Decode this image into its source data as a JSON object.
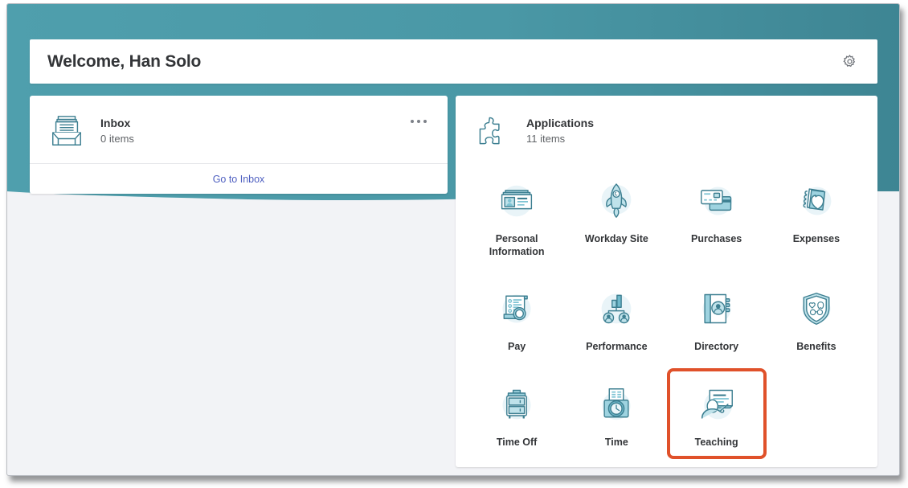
{
  "header": {
    "welcome_title": "Welcome, Han Solo",
    "settings_icon": "gear-icon"
  },
  "inbox": {
    "icon": "inbox-tray-icon",
    "title": "Inbox",
    "subtitle": "0 items",
    "menu_icon": "ellipsis-icon",
    "footer_link": "Go to Inbox"
  },
  "applications": {
    "icon": "puzzle-piece-icon",
    "title": "Applications",
    "subtitle": "11 items",
    "items": [
      {
        "label": "Personal\nInformation",
        "icon": "id-card-icon",
        "highlighted": false
      },
      {
        "label": "Workday Site",
        "icon": "rocket-icon",
        "highlighted": false
      },
      {
        "label": "Purchases",
        "icon": "credit-cards-icon",
        "highlighted": false
      },
      {
        "label": "Expenses",
        "icon": "hand-cash-icon",
        "highlighted": false
      },
      {
        "label": "Pay",
        "icon": "pay-statement-icon",
        "highlighted": false
      },
      {
        "label": "Performance",
        "icon": "org-chart-icon",
        "highlighted": false
      },
      {
        "label": "Directory",
        "icon": "address-book-icon",
        "highlighted": false
      },
      {
        "label": "Benefits",
        "icon": "shield-benefits-icon",
        "highlighted": false
      },
      {
        "label": "Time Off",
        "icon": "suitcase-icon",
        "highlighted": false
      },
      {
        "label": "Time",
        "icon": "time-clock-icon",
        "highlighted": false
      },
      {
        "label": "Teaching",
        "icon": "teaching-board-icon",
        "highlighted": true
      }
    ]
  },
  "colors": {
    "banner_teal": "#4b99a7",
    "banner_teal_dark": "#3f8693",
    "page_background": "#f2f3f6",
    "card_white": "#ffffff",
    "link_blue": "#4e5fc0",
    "highlight_orange": "#e0512a",
    "icon_stroke": "#3d7f91",
    "icon_fill_light": "#bfe2ea",
    "text_dark": "#333538",
    "text_muted": "#5f6266"
  }
}
